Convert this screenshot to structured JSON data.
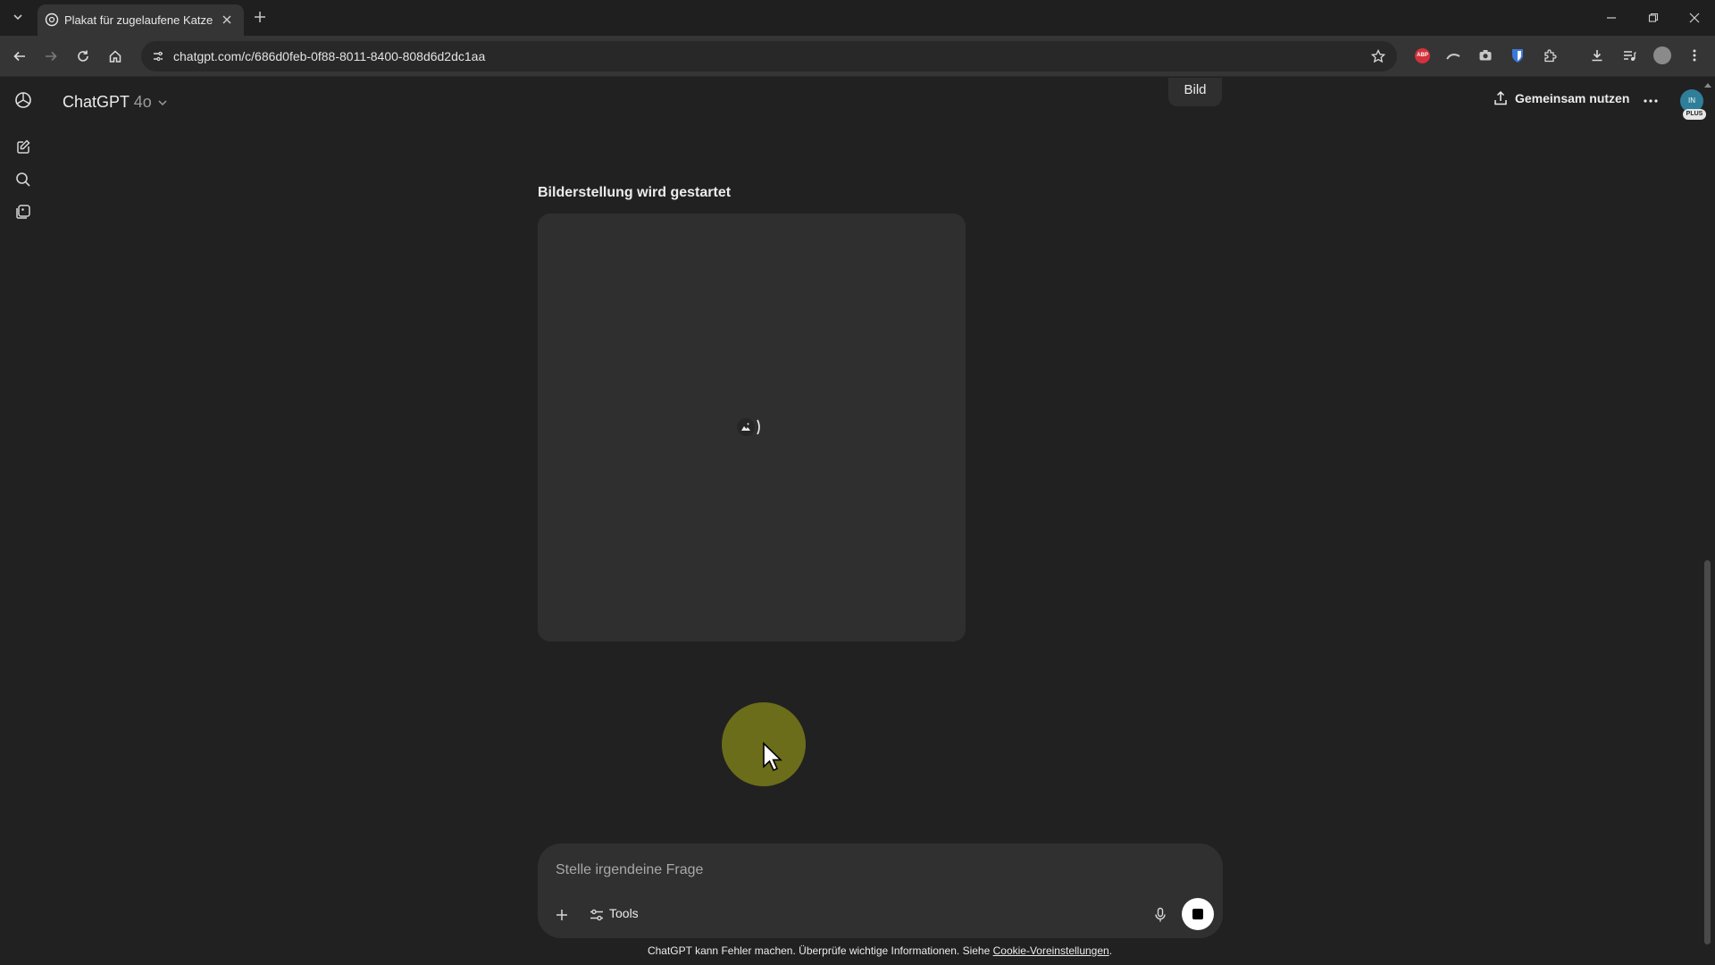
{
  "browser": {
    "tab_title": "Plakat für zugelaufene Katze",
    "url": "chatgpt.com/c/686d0feb-0f88-8011-8400-808d6d2dc1aa",
    "ext_abp": "ABP"
  },
  "app": {
    "model_name": "ChatGPT",
    "model_version": "4o",
    "bild_label": "Bild",
    "share_label": "Gemeinsam nutzen",
    "avatar_initials": "IN",
    "plan_badge": "PLUS",
    "status_text": "Bilderstellung wird gestartet",
    "composer": {
      "placeholder": "Stelle irgendeine Frage",
      "tools_label": "Tools"
    },
    "footer": {
      "text": "ChatGPT kann Fehler machen. Überprüfe wichtige Informationen. Siehe ",
      "link": "Cookie-Voreinstellungen",
      "suffix": "."
    }
  },
  "colors": {
    "background": "#212121",
    "surface": "#2f2f2f",
    "composer": "#303030",
    "cursor_highlight": "#6b6d1a"
  }
}
